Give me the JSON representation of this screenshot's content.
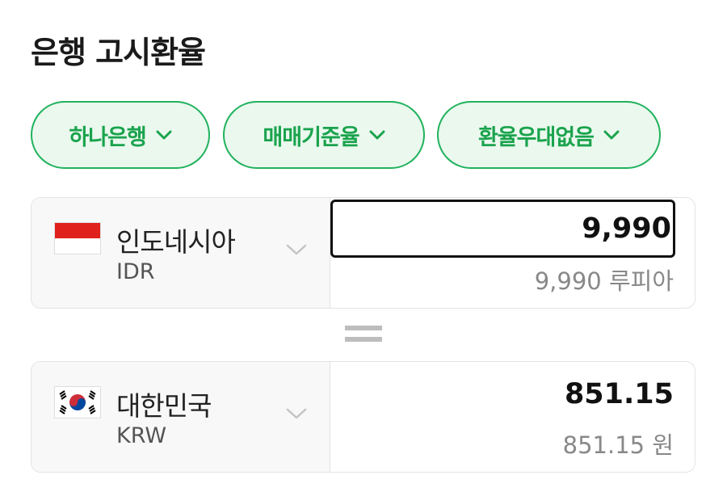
{
  "title": "은행 고시환율",
  "filters": [
    {
      "label": "하나은행",
      "icon": "chevron-down-icon"
    },
    {
      "label": "매매기준율",
      "icon": "chevron-down-icon"
    },
    {
      "label": "환율우대없음",
      "icon": "chevron-down-icon"
    }
  ],
  "from": {
    "country": "인도네시아",
    "code": "IDR",
    "flag": "indonesia-flag-icon",
    "input_value": "9,990",
    "formatted": "9,990 루피아"
  },
  "operator": "equals-icon",
  "to": {
    "country": "대한민국",
    "code": "KRW",
    "flag": "south-korea-flag-icon",
    "value": "851.15",
    "formatted": "851.15 원"
  },
  "colors": {
    "accent_green": "#1aa34d",
    "chip_bg": "#eaf8ee"
  }
}
